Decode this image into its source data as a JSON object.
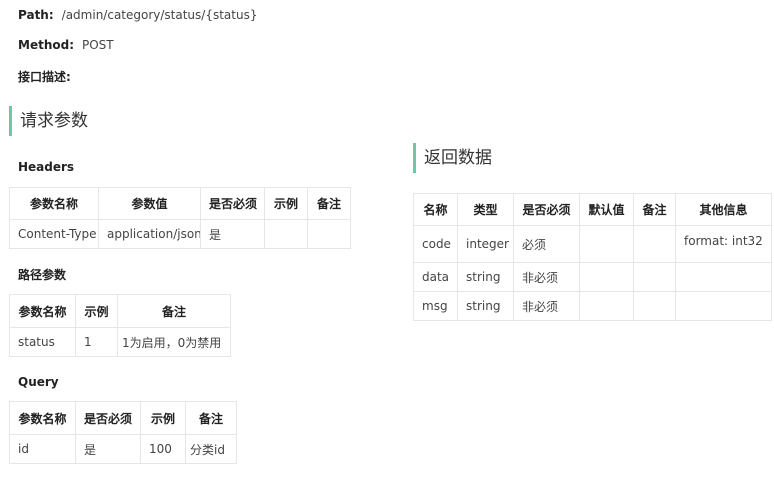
{
  "info": {
    "path_label": "Path:",
    "path_value": "/admin/category/status/{status}",
    "method_label": "Method:",
    "method_value": "POST",
    "desc_label": "接口描述:"
  },
  "request": {
    "title": "请求参数",
    "headers": {
      "title": "Headers",
      "columns": [
        "参数名称",
        "参数值",
        "是否必须",
        "示例",
        "备注"
      ],
      "rows": [
        [
          "Content-Type",
          "application/json",
          "是",
          "",
          ""
        ]
      ]
    },
    "path_params": {
      "title": "路径参数",
      "columns": [
        "参数名称",
        "示例",
        "备注"
      ],
      "rows": [
        [
          "status",
          "1",
          "1为启用，0为禁用"
        ]
      ]
    },
    "query": {
      "title": "Query",
      "columns": [
        "参数名称",
        "是否必须",
        "示例",
        "备注"
      ],
      "rows": [
        [
          "id",
          "是",
          "100",
          "分类id"
        ]
      ]
    }
  },
  "response": {
    "title": "返回数据",
    "columns": [
      "名称",
      "类型",
      "是否必须",
      "默认值",
      "备注",
      "其他信息"
    ],
    "rows": [
      [
        "code",
        "integer",
        "必须",
        "",
        "",
        "format: int32"
      ],
      [
        "data",
        "string",
        "非必须",
        "",
        "",
        ""
      ],
      [
        "msg",
        "string",
        "非必须",
        "",
        "",
        ""
      ]
    ]
  },
  "colors": {
    "accent": "#6cc9a6",
    "border": "#e6e6e6"
  }
}
